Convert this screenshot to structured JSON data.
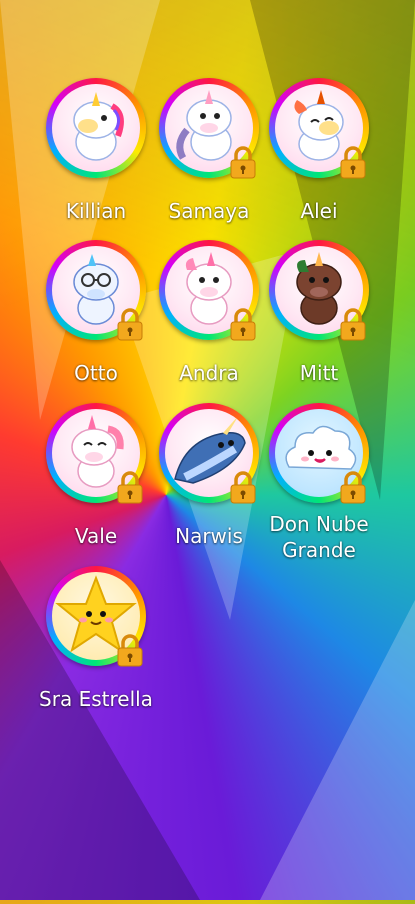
{
  "characters": [
    {
      "name": "Killian",
      "icon": "unicorn-icon",
      "locked": false
    },
    {
      "name": "Samaya",
      "icon": "unicorn-icon",
      "locked": true
    },
    {
      "name": "Alei",
      "icon": "unicorn-icon",
      "locked": true
    },
    {
      "name": "Otto",
      "icon": "unicorn-glasses-icon",
      "locked": true
    },
    {
      "name": "Andra",
      "icon": "unicorn-icon",
      "locked": true
    },
    {
      "name": "Mitt",
      "icon": "brown-unicorn-icon",
      "locked": true
    },
    {
      "name": "Vale",
      "icon": "unicorn-icon",
      "locked": true
    },
    {
      "name": "Narwis",
      "icon": "narwhal-icon",
      "locked": true
    },
    {
      "name": "Don Nube Grande",
      "icon": "cloud-icon",
      "locked": true
    },
    {
      "name": "Sra Estrella",
      "icon": "star-icon",
      "locked": true
    }
  ],
  "colors": {
    "lock_gold": "#e8a317",
    "label_text": "#ffffff"
  }
}
